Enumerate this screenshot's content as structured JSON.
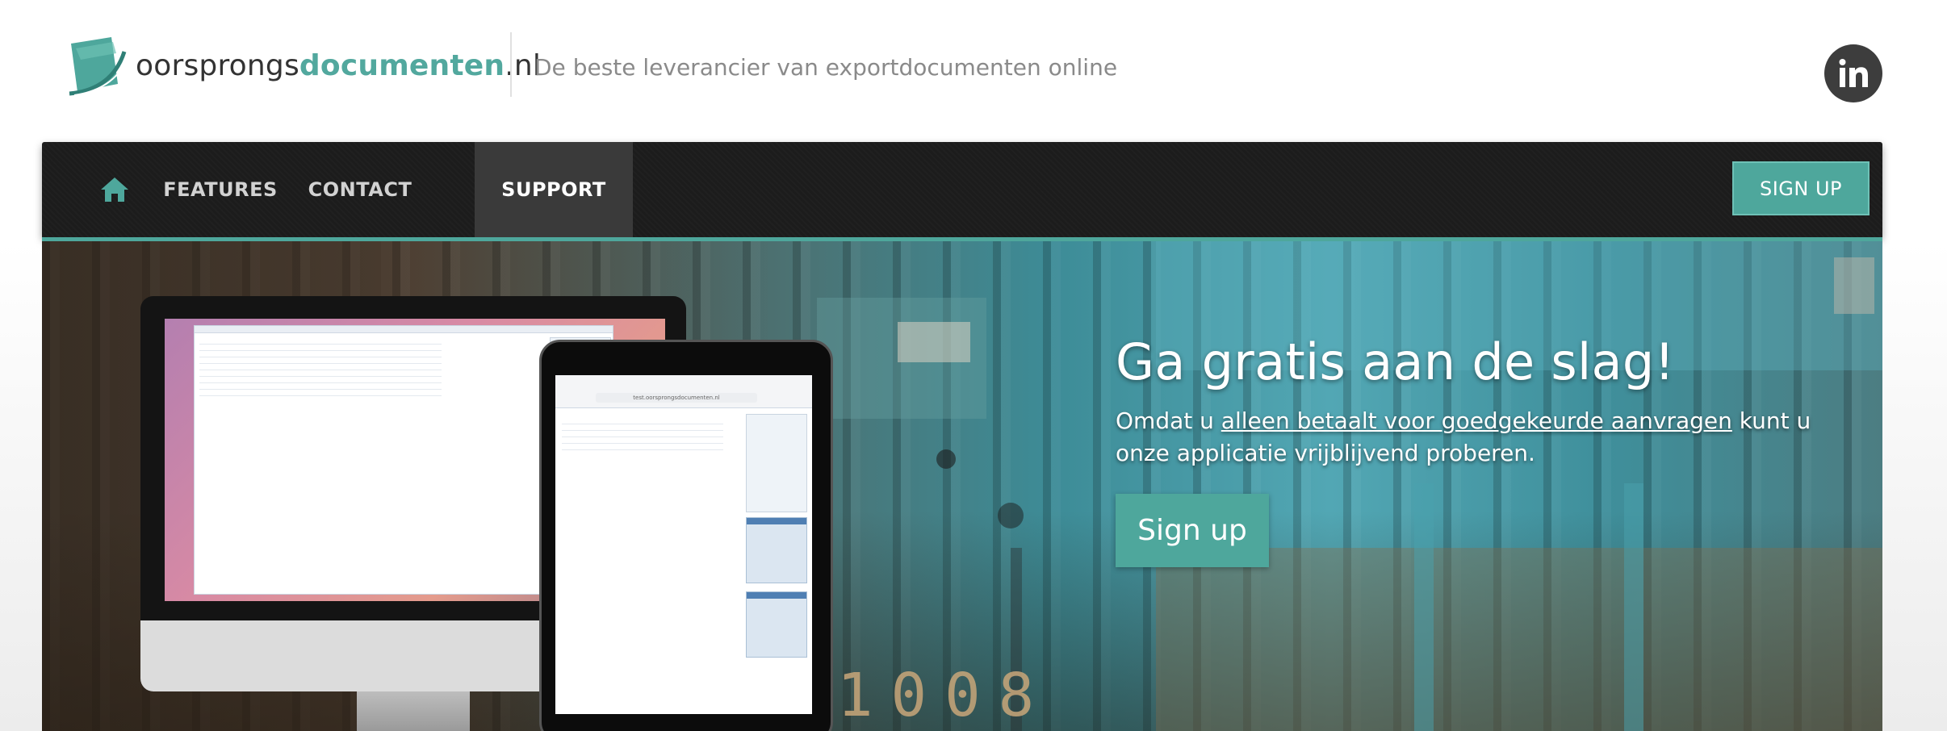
{
  "brand": {
    "name_part1": "oorsprongs",
    "name_part2": "documenten",
    "name_part3": ".nl",
    "tagline": "De beste leverancier van exportdocumenten online",
    "accent_color": "#4ea79c"
  },
  "social": {
    "icon": "linkedin-icon",
    "label": "in"
  },
  "nav": {
    "home_icon": "home-icon",
    "items": [
      {
        "label": "FEATURES"
      },
      {
        "label": "CONTACT"
      },
      {
        "label": "SUPPORT",
        "active": true
      }
    ],
    "signup_label": "SIGN UP"
  },
  "hero": {
    "title": "Ga gratis aan de slag!",
    "text_before": "Omdat u ",
    "text_link": "alleen betaalt voor goedgekeurde aanvragen",
    "text_after": " kunt u onze applicatie vrijblijvend proberen.",
    "button_label": "Sign up",
    "container_digits": "1008",
    "ipad_url": "test.oorsprongsdocumenten.nl"
  },
  "colors": {
    "nav_bg": "#1c1c1c",
    "nav_active_bg": "#3a3a3a",
    "teal": "#4ea79c",
    "linkedin_bg": "#3d3d3d"
  }
}
